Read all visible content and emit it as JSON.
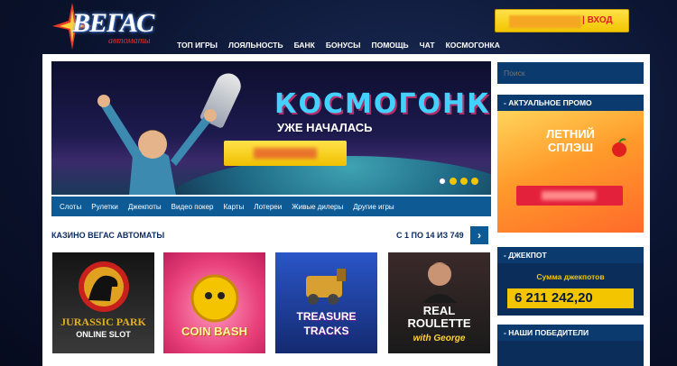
{
  "header": {
    "logo_text": "ВЕГАС",
    "logo_sub": "автоматы",
    "login_label": "| ВХОД",
    "nav": [
      "ТОП ИГРЫ",
      "ЛОЯЛЬНОСТЬ",
      "БАНК",
      "БОНУСЫ",
      "ПОМОЩЬ",
      "ЧАТ",
      "КОСМОГОНКА"
    ]
  },
  "banner": {
    "title": "КОСМОГОНКА",
    "subtitle": "УЖЕ НАЧАЛАСЬ"
  },
  "categories": [
    "Слоты",
    "Рулетки",
    "Джекпоты",
    "Видео покер",
    "Карты",
    "Лотереи",
    "Живые дилеры",
    "Другие игры"
  ],
  "section": {
    "title": "КАЗИНО ВЕГАС АВТОМАТЫ",
    "count": "С 1 ПО 14 ИЗ 749",
    "next_icon": "›"
  },
  "games": [
    {
      "line1": "JURASSIC PARK",
      "line2": "ONLINE SLOT"
    },
    {
      "line1": "COIN BASH",
      "line2": ""
    },
    {
      "line1": "TREASURE",
      "line2": "TRACKS"
    },
    {
      "line1": "REAL ROULETTE",
      "line2": "with George"
    }
  ],
  "sidebar": {
    "search_placeholder": "Поиск",
    "promo_head": "- АКТУАЛЬНОЕ ПРОМО",
    "promo_title_1": "ЛЕТНИЙ",
    "promo_title_2": "СПЛЭШ",
    "jackpot_head": "- ДЖЕКПОТ",
    "jackpot_label": "Сумма джекпотов",
    "jackpot_value": "6 211 242,20",
    "winners_head": "- НАШИ ПОБЕДИТЕЛИ"
  },
  "colors": {
    "accent_yellow": "#f2c500",
    "nav_blue": "#0e5a95",
    "panel_blue": "#0b3a6e",
    "login_text": "#e0201c"
  }
}
